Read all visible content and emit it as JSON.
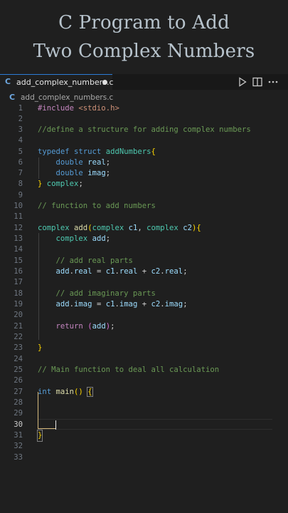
{
  "title": {
    "line1": "C Program to Add",
    "line2": "Two Complex Numbers"
  },
  "tab": {
    "file_icon": "C",
    "label": "add_complex_numbers.c",
    "unsaved": true
  },
  "toolbar": {
    "run_icon": "play-icon",
    "split_icon": "split-editor-icon",
    "more_icon": "more-icon"
  },
  "breadcrumb": {
    "file_icon": "C",
    "file": "add_complex_numbers.c"
  },
  "editor": {
    "active_line": 30,
    "line_numbers": [
      "1",
      "2",
      "3",
      "4",
      "5",
      "6",
      "7",
      "8",
      "9",
      "10",
      "11",
      "12",
      "13",
      "14",
      "15",
      "16",
      "17",
      "18",
      "19",
      "20",
      "21",
      "22",
      "23",
      "24",
      "25",
      "26",
      "27",
      "28",
      "29",
      "30",
      "31",
      "32",
      "33"
    ],
    "lines": [
      "#include <stdio.h>",
      "",
      "//define a structure for adding complex numbers",
      "",
      "typedef struct addNumbers{",
      "    double real;",
      "    double imag;",
      "} complex;",
      "",
      "// function to add numbers",
      "",
      "complex add(complex c1, complex c2){",
      "    complex add;",
      "",
      "    // add real parts",
      "    add.real = c1.real + c2.real;",
      "",
      "    // add imaginary parts",
      "    add.imag = c1.imag + c2.imag;",
      "",
      "    return (add);",
      "",
      "}",
      "",
      "// Main function to deal all calculation",
      "",
      "int main() {",
      "",
      "",
      "",
      "}",
      "",
      ""
    ]
  }
}
